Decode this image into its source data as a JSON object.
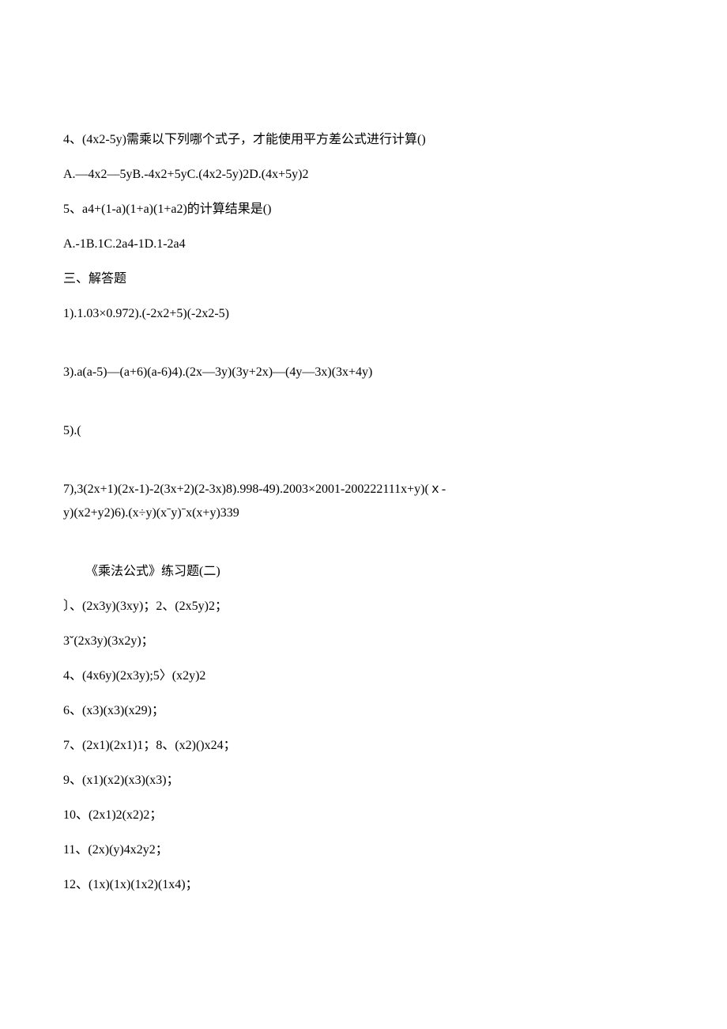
{
  "lines": [
    {
      "text": "4、(4x2-5y)需乘以下列哪个式子，才能使用平方差公式进行计算()",
      "class": "line"
    },
    {
      "text": "A.—4x2—5yB.-4x2+5yC.(4x2-5y)2D.(4x+5y)2",
      "class": "line"
    },
    {
      "text": "5、a4+(1-a)(1+a)(1+a2)的计算结果是()",
      "class": "line"
    },
    {
      "text": "A.-1B.1C.2a4-1D.1-2a4",
      "class": "line"
    },
    {
      "text": "三、解答题",
      "class": "line"
    },
    {
      "text": "1).1.03×0.972).(-2x2+5)(-2x2-5)",
      "class": "line spaced"
    },
    {
      "text": "3).a(a-5)—(a+6)(a-6)4).(2x—3y)(3y+2x)—(4y—3x)(3x+4y)",
      "class": "line spaced"
    },
    {
      "text": "5).(",
      "class": "line spaced"
    },
    {
      "text": "7),3(2x+1)(2x-1)-2(3x+2)(2-3x)8).998-49).2003×2001-200222111x+y)(ｘ-",
      "class": "line tight"
    },
    {
      "text": "y)(x2+y2)6).(x÷y)(xˉy)ˉx(x+y)339",
      "class": "line spaced"
    },
    {
      "text": "《乘法公式》练习题(二)",
      "class": "line indent"
    },
    {
      "text": "〕、(2x3y)(3xy)；2、(2x5y)2；",
      "class": "line"
    },
    {
      "text": "3ˇ(2x3y)(3x2y)；",
      "class": "line"
    },
    {
      "text": "4、(4x6y)(2x3y);5〉(x2y)2",
      "class": "line"
    },
    {
      "text": "6、(x3)(x3)(x29)；",
      "class": "line"
    },
    {
      "text": "7、(2x1)(2x1)1；8、(x2)()x24；",
      "class": "line"
    },
    {
      "text": "9、(x1)(x2)(x3)(x3)；",
      "class": "line"
    },
    {
      "text": "10、(2x1)2(x2)2；",
      "class": "line"
    },
    {
      "text": "11、(2x)(y)4x2y2；",
      "class": "line"
    },
    {
      "text": "12、(1x)(1x)(1x2)(1x4)；",
      "class": "line"
    }
  ]
}
